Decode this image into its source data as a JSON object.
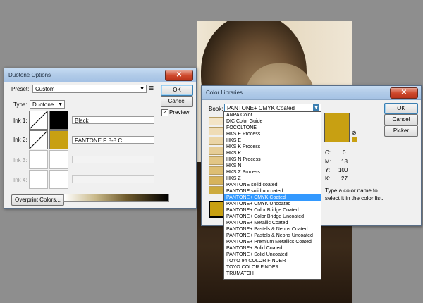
{
  "duotone": {
    "title": "Duotone Options",
    "preset_label": "Preset:",
    "preset_value": "Custom",
    "type_label": "Type:",
    "type_value": "Duotone",
    "inks": [
      {
        "label": "Ink 1:",
        "name": "Black",
        "color": "#000000"
      },
      {
        "label": "Ink 2:",
        "name": "PANTONE P 8-8 C",
        "color": "#c8a012"
      },
      {
        "label": "Ink 3:",
        "name": "",
        "color": "#ffffff"
      },
      {
        "label": "Ink 4:",
        "name": "",
        "color": "#ffffff"
      }
    ],
    "ok_label": "OK",
    "cancel_label": "Cancel",
    "preview_label": "Preview",
    "preview_checked": true,
    "overprint_label": "Overprint Colors..."
  },
  "color_libraries": {
    "title": "Color Libraries",
    "book_label": "Book:",
    "book_value": "PANTONE+ CMYK Coated",
    "ok_label": "OK",
    "cancel_label": "Cancel",
    "picker_label": "Picker",
    "selected_color": "#c8a012",
    "cmyk": [
      {
        "label": "C:",
        "value": "0"
      },
      {
        "label": "M:",
        "value": "18"
      },
      {
        "label": "Y:",
        "value": "100"
      },
      {
        "label": "K:",
        "value": "27"
      }
    ],
    "hint_line1": "Type a color name to",
    "hint_line2": "select it in the color list.",
    "books": [
      "ANPA Color",
      "DIC Color Guide",
      "FOCOLTONE",
      "HKS E Process",
      "HKS E",
      "HKS K Process",
      "HKS K",
      "HKS N Process",
      "HKS N",
      "HKS Z Process",
      "HKS Z",
      "PANTONE solid coated",
      "PANTONE solid uncoated",
      "PANTONE+ CMYK Coated",
      "PANTONE+ CMYK Uncoated",
      "PANTONE+ Color Bridge Coated",
      "PANTONE+ Color Bridge Uncoated",
      "PANTONE+ Metallic Coated",
      "PANTONE+ Pastels & Neons Coated",
      "PANTONE+ Pastels & Neons Uncoated",
      "PANTONE+ Premium Metallics Coated",
      "PANTONE+ Solid Coated",
      "PANTONE+ Solid Uncoated",
      "TOYO 94 COLOR FINDER",
      "TOYO COLOR FINDER",
      "TRUMATCH"
    ],
    "selected_index": 13,
    "strip_colors": [
      "#f3e4c6",
      "#efdcb6",
      "#ebd5a6",
      "#e6cd96",
      "#e2c685",
      "#ddbe73",
      "#d6b35c",
      "#ccaa3e",
      "#c8a012"
    ]
  }
}
